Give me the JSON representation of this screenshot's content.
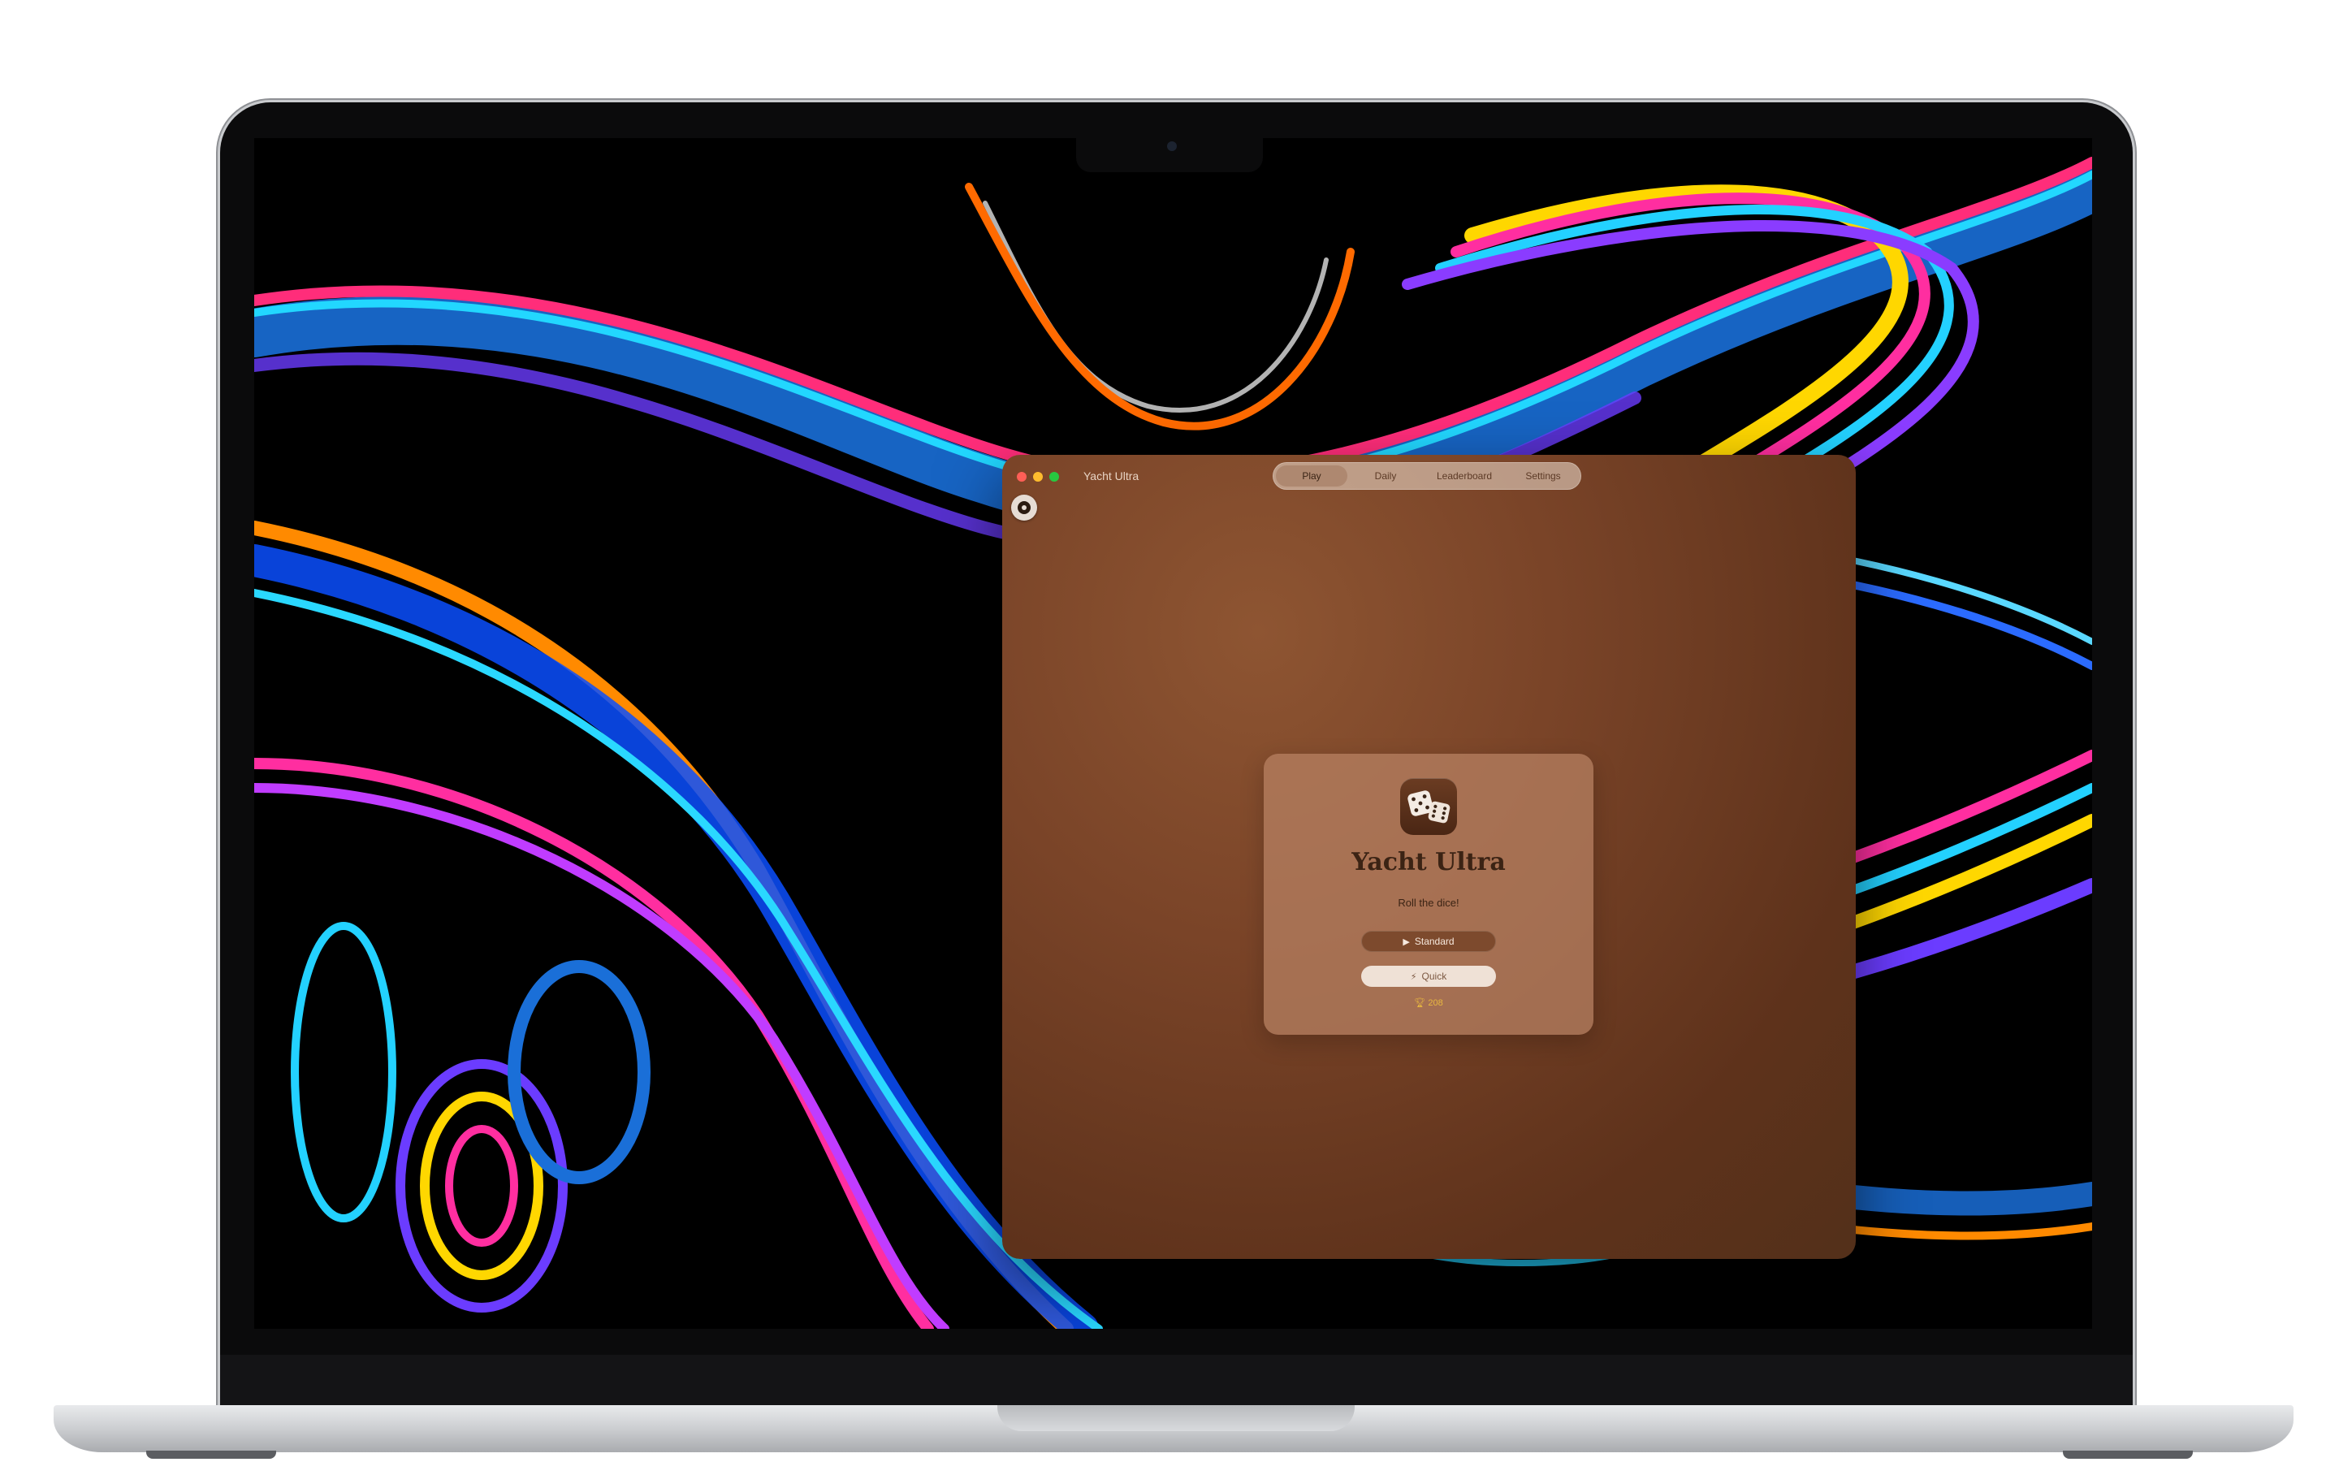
{
  "window": {
    "title": "Yacht Ultra",
    "tabs": [
      {
        "label": "Play",
        "active": true
      },
      {
        "label": "Daily",
        "active": false
      },
      {
        "label": "Leaderboard",
        "active": false
      },
      {
        "label": "Settings",
        "active": false
      }
    ]
  },
  "card": {
    "title": "Yacht Ultra",
    "subtitle": "Roll the dice!",
    "standard_button": "Standard",
    "quick_button": "Quick",
    "score": "208",
    "icons": {
      "standard": "play-icon",
      "quick": "bolt-icon",
      "score": "trophy-icon",
      "app": "dice-icon"
    }
  },
  "colors": {
    "window_bg": "#7a4428",
    "card_bg": "#b98264",
    "standard_button": "#7d4a2d",
    "quick_button": "#efe1d6",
    "score": "#e8b840"
  }
}
